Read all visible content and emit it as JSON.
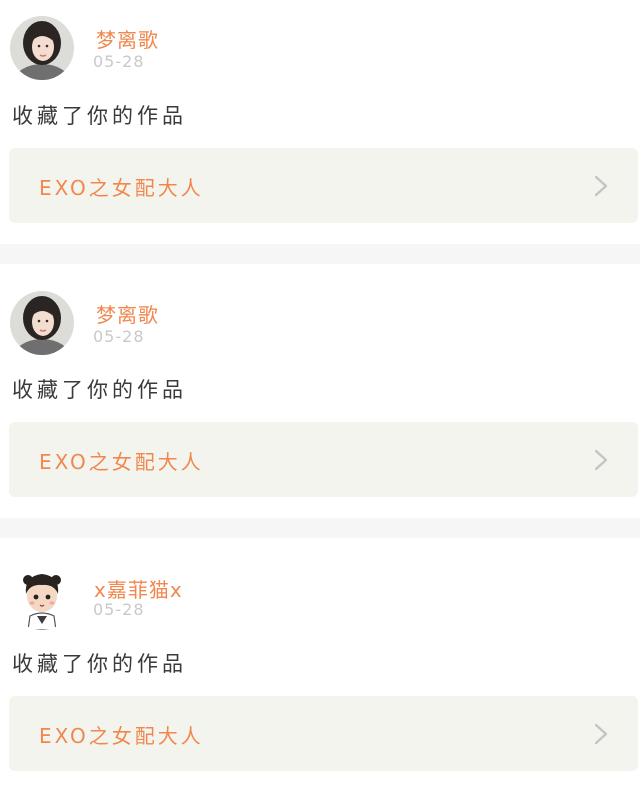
{
  "feed": {
    "items": [
      {
        "username": "梦离歌",
        "date": "05-28",
        "action": "收藏了你的作品",
        "work_title": "EXO之女配大人",
        "avatar_icon": "girl-portrait-avatar"
      },
      {
        "username": "梦离歌",
        "date": "05-28",
        "action": "收藏了你的作品",
        "work_title": "EXO之女配大人",
        "avatar_icon": "girl-portrait-avatar"
      },
      {
        "username": "x嘉菲猫x",
        "date": "05-28",
        "action": "收藏了你的作品",
        "work_title": "EXO之女配大人",
        "avatar_icon": "cartoon-boy-avatar"
      }
    ]
  },
  "colors": {
    "accent": "#f0884e",
    "date": "#c9c9c9",
    "body_text": "#3a3a3a",
    "link_background": "#f4f4ee",
    "separator": "#f6f6f6",
    "chevron": "#c4c4c4"
  }
}
